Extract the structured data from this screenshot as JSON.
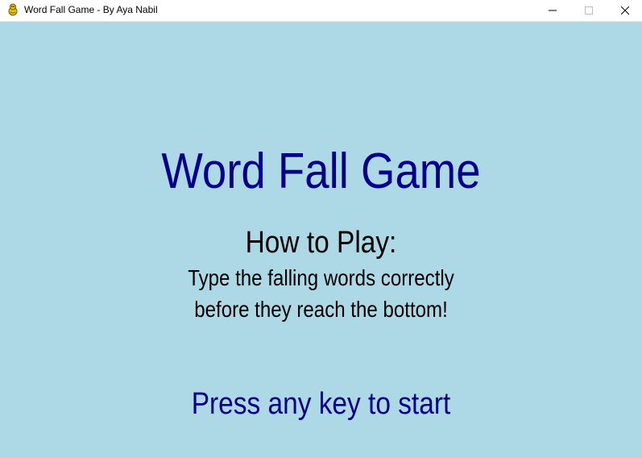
{
  "window": {
    "title": "Word Fall Game - By Aya Nabil",
    "icon": "pygame-snake-icon",
    "controls": {
      "minimize_icon": "minimize-icon",
      "maximize_icon": "maximize-icon",
      "close_icon": "close-icon"
    }
  },
  "screen": {
    "background_color": "#add8e6",
    "title": "Word Fall Game",
    "title_color": "#00008b",
    "howto_heading": "How to Play:",
    "instructions": [
      "Type the falling words correctly",
      "before they reach the bottom!"
    ],
    "start_prompt": "Press any key to start",
    "start_prompt_color": "#00008b"
  }
}
